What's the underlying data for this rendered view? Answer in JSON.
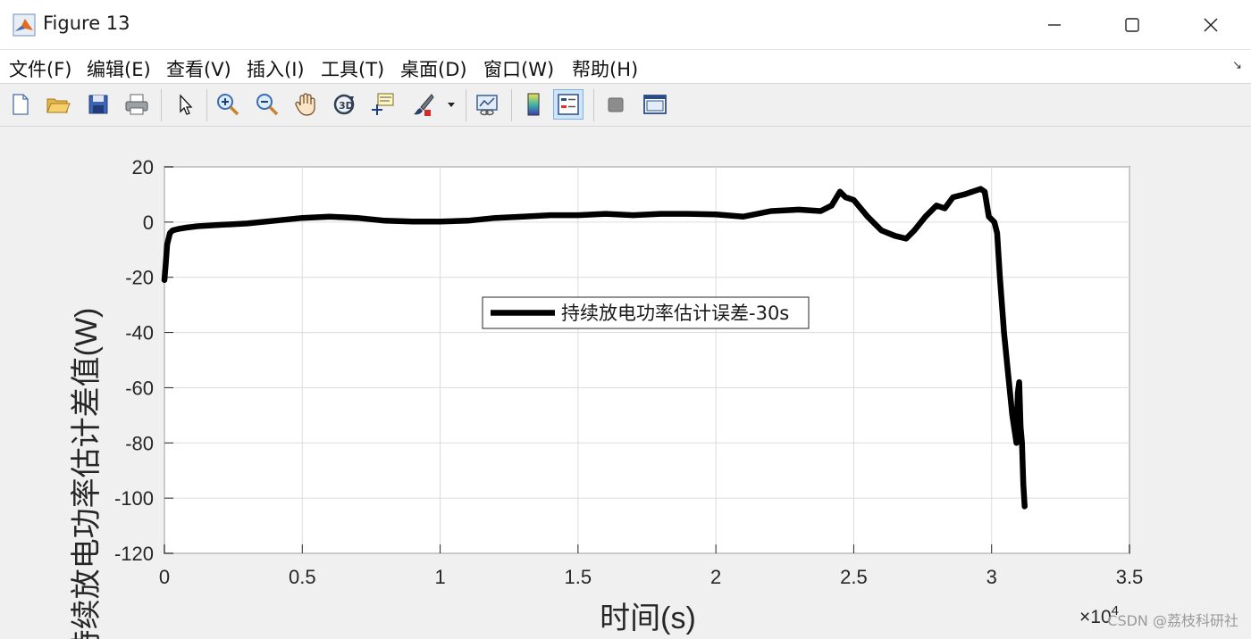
{
  "window": {
    "title": "Figure 13",
    "minimize_icon": "minimize-icon",
    "maximize_icon": "maximize-icon",
    "close_icon": "close-icon"
  },
  "menu": {
    "items": [
      "文件(F)",
      "编辑(E)",
      "查看(V)",
      "插入(I)",
      "工具(T)",
      "桌面(D)",
      "窗口(W)",
      "帮助(H)"
    ]
  },
  "toolbar": {
    "buttons": [
      "new-figure-icon",
      "open-file-icon",
      "save-icon",
      "print-icon",
      "select-arrow-icon",
      "zoom-in-icon",
      "zoom-out-icon",
      "pan-hand-icon",
      "rotate-3d-icon",
      "data-cursor-icon",
      "brush-icon",
      "link-plot-icon",
      "colorbar-icon",
      "legend-icon",
      "hide-plot-tools-icon",
      "show-plot-tools-icon"
    ]
  },
  "chart_data": {
    "type": "line",
    "title": "",
    "xlabel": "时间(s)",
    "ylabel": "持续放电功率估计差值(W)",
    "x_exponent_label": "×10",
    "x_exponent_power": "4",
    "xlim": [
      0,
      3.5
    ],
    "ylim": [
      -120,
      20
    ],
    "xticks": [
      "0",
      "0.5",
      "1",
      "1.5",
      "2",
      "2.5",
      "3",
      "3.5"
    ],
    "yticks": [
      "20",
      "0",
      "-20",
      "-40",
      "-60",
      "-80",
      "-100",
      "-120"
    ],
    "grid": true,
    "legend_placement": "center",
    "line_color": "#000000",
    "series": [
      {
        "name": "持续放电功率估计误差-30s",
        "x": [
          0,
          0.005,
          0.01,
          0.02,
          0.03,
          0.05,
          0.08,
          0.12,
          0.2,
          0.3,
          0.4,
          0.5,
          0.6,
          0.7,
          0.8,
          0.9,
          1.0,
          1.1,
          1.2,
          1.3,
          1.4,
          1.5,
          1.6,
          1.7,
          1.8,
          1.9,
          2.0,
          2.1,
          2.2,
          2.3,
          2.38,
          2.42,
          2.45,
          2.47,
          2.5,
          2.55,
          2.6,
          2.65,
          2.69,
          2.72,
          2.76,
          2.8,
          2.83,
          2.86,
          2.9,
          2.93,
          2.96,
          2.975,
          2.99,
          3.0,
          3.01,
          3.02,
          3.03,
          3.045,
          3.06,
          3.075,
          3.09,
          3.095,
          3.1,
          3.105,
          3.11,
          3.115,
          3.12
        ],
        "y": [
          -21,
          -15,
          -8,
          -4,
          -3,
          -2.5,
          -2,
          -1.5,
          -1,
          -0.5,
          0.5,
          1.5,
          2,
          1.5,
          0.5,
          0.2,
          0.2,
          0.5,
          1.5,
          2,
          2.5,
          2.5,
          3,
          2.5,
          3,
          3,
          2.8,
          2,
          4,
          4.5,
          4,
          6,
          11,
          9,
          8,
          2,
          -3,
          -5,
          -6,
          -3,
          2,
          6,
          5,
          9,
          10,
          11,
          12,
          11,
          2,
          1,
          0,
          -4,
          -20,
          -40,
          -55,
          -70,
          -80,
          -62,
          -58,
          -74,
          -80,
          -95,
          -103
        ]
      }
    ]
  },
  "watermark": "CSDN @荔枝科研社"
}
